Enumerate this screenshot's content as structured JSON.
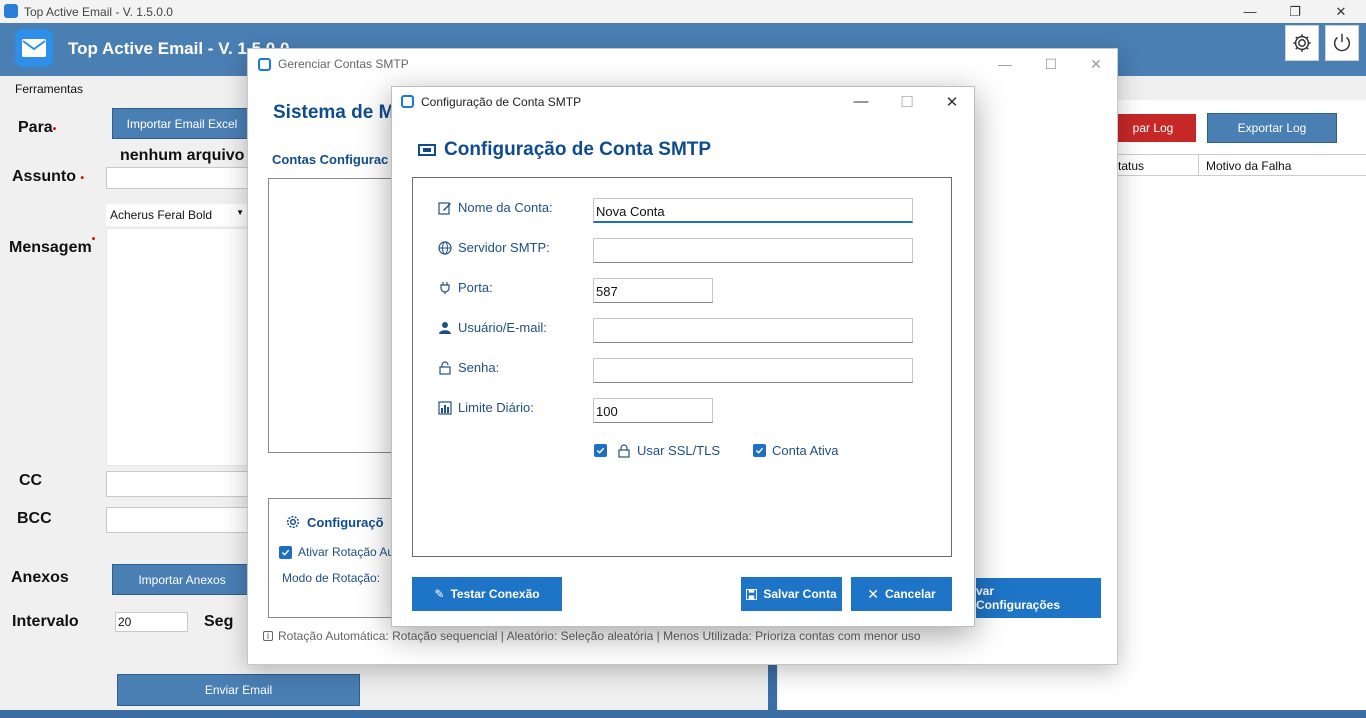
{
  "main": {
    "window_title": "Top Active Email - V. 1.5.0.0",
    "app_title": "Top Active Email - V. 1.5.0.0",
    "menu": "Ferramentas",
    "para_label": "Para",
    "import_excel_label": "Importar Email Excel",
    "no_file_text": "nenhum arquivo",
    "assunto_label": "Assunto",
    "font_value": "Acherus Feral Bold",
    "mensagem_label": "Mensagem",
    "cc_label": "CC",
    "bcc_label": "BCC",
    "anexos_label": "Anexos",
    "import_anexos_label": "Importar Anexos",
    "intervalo_label": "Intervalo",
    "intervalo_value": "20",
    "seg_label": "Seg",
    "send_label": "Enviar Email",
    "clear_log_label": "par Log",
    "export_log_label": "Exportar Log",
    "col_status": "tatus",
    "col_motivo": "Motivo da Falha"
  },
  "manager": {
    "title": "Gerenciar Contas SMTP",
    "heading": "Sistema de M",
    "accounts_label": "Contas Configurac",
    "config_section": "Configuraçõ",
    "rotation_check": "Ativar Rotação Au",
    "rotation_mode": "Modo de Rotação:",
    "save_config": "var Configurações",
    "info": "Rotação Automática: Rotação sequencial | Aleatório: Seleção aleatória | Menos Utilizada: Prioriza contas com menor uso"
  },
  "config": {
    "title": "Configuração de Conta SMTP",
    "heading": "Configuração de Conta SMTP",
    "fields": {
      "name_label": "Nome da Conta:",
      "name_value": "Nova Conta",
      "server_label": "Servidor SMTP:",
      "server_value": "",
      "port_label": "Porta:",
      "port_value": "587",
      "user_label": "Usuário/E-mail:",
      "user_value": "",
      "password_label": "Senha:",
      "password_value": "",
      "limit_label": "Limite Diário:",
      "limit_value": "100"
    },
    "ssl_label": "Usar SSL/TLS",
    "active_label": "Conta Ativa",
    "test_btn": "Testar Conexão",
    "save_btn": "Salvar Conta",
    "cancel_btn": "Cancelar"
  },
  "colors": {
    "accent": "#1e74c6",
    "header": "#4a7fb4",
    "danger": "#c62828"
  }
}
